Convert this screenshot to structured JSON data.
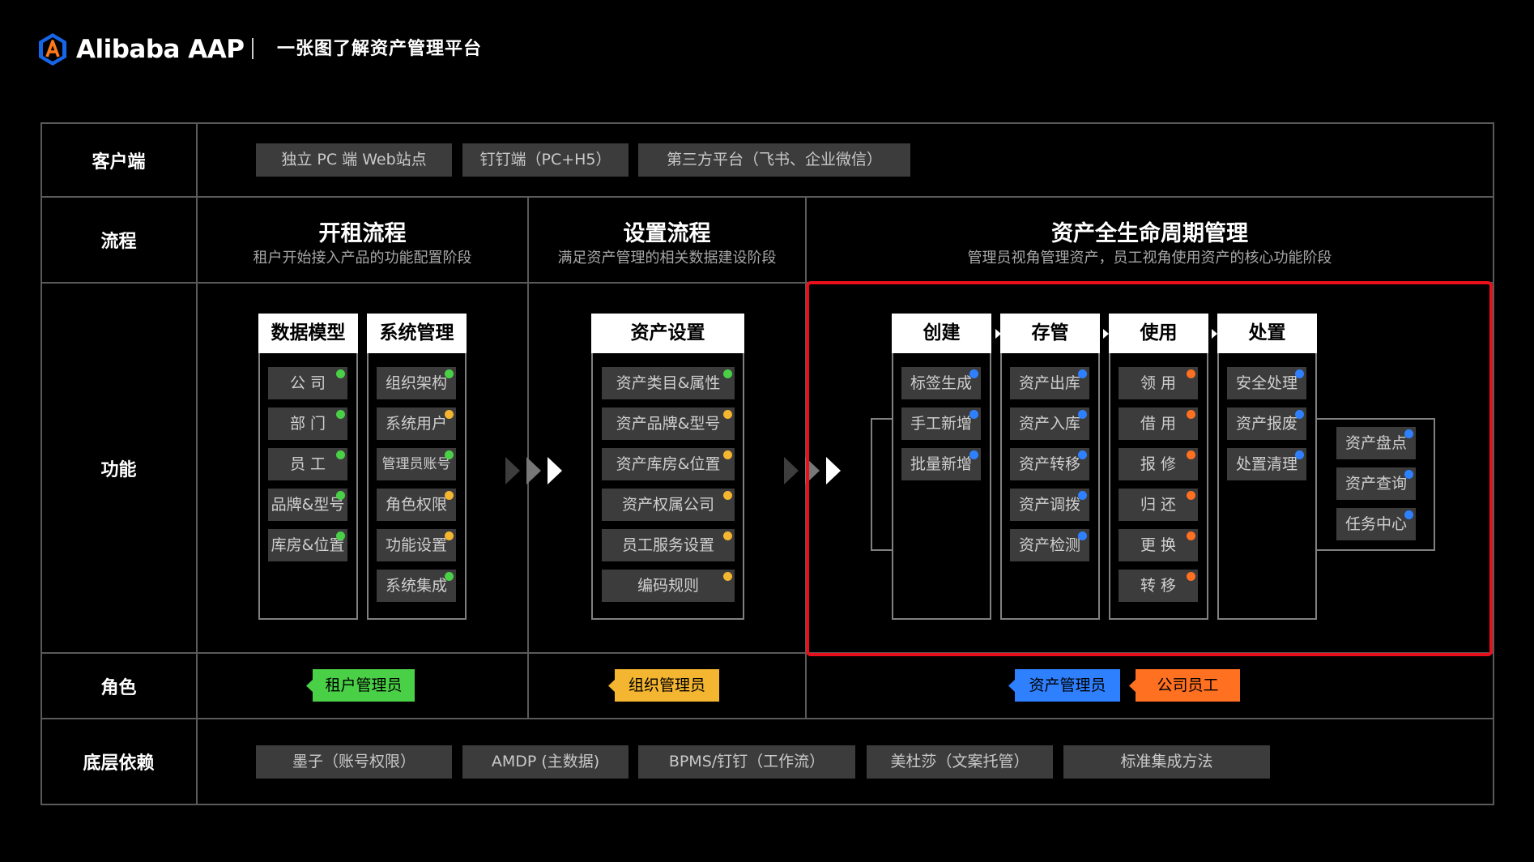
{
  "header": {
    "brand": "Alibaba AAP",
    "title": "一张图了解资产管理平台"
  },
  "rows": {
    "client": "客户端",
    "process": "流程",
    "function": "功能",
    "role": "角色",
    "foundation": "底层依赖"
  },
  "clients": [
    "独立 PC 端 Web站点",
    "钉钉端（PC+H5）",
    "第三方平台（飞书、企业微信）"
  ],
  "flows": [
    {
      "title": "开租流程",
      "subtitle": "租户开始接入产品的功能配置阶段"
    },
    {
      "title": "设置流程",
      "subtitle": "满足资产管理的相关数据建设阶段"
    },
    {
      "title": "资产全生命周期管理",
      "subtitle": "管理员视角管理资产，员工视角使用资产的核心功能阶段"
    }
  ],
  "modules": {
    "data_model": {
      "title": "数据模型",
      "items": [
        "公 司",
        "部 门",
        "员 工",
        "品牌&型号",
        "库房&位置"
      ]
    },
    "system_mgmt": {
      "title": "系统管理",
      "items": [
        "组织架构",
        "系统用户",
        "管理员账号",
        "角色权限",
        "功能设置",
        "系统集成"
      ]
    },
    "asset_setup": {
      "title": "资产设置",
      "items": [
        "资产类目&属性",
        "资产品牌&型号",
        "资产库房&位置",
        "资产权属公司",
        "员工服务设置",
        "编码规则"
      ]
    },
    "create": {
      "title": "创建",
      "items": [
        "标签生成",
        "手工新增",
        "批量新增"
      ]
    },
    "manage": {
      "title": "存管",
      "items": [
        "资产出库",
        "资产入库",
        "资产转移",
        "资产调拨",
        "资产检测"
      ]
    },
    "use": {
      "title": "使用",
      "items": [
        "领 用",
        "借 用",
        "报 修",
        "归 还",
        "更 换",
        "转 移"
      ]
    },
    "dispose": {
      "title": "处置",
      "items": [
        "安全处理",
        "资产报废",
        "处置清理"
      ]
    },
    "side": {
      "items": [
        "资产盘点",
        "资产查询",
        "任务中心"
      ]
    }
  },
  "roles": {
    "tenant_admin": "租户管理员",
    "org_admin": "组织管理员",
    "asset_admin": "资产管理员",
    "employee": "公司员工"
  },
  "foundation": [
    "墨子（账号权限）",
    "AMDP (主数据)",
    "BPMS/钉钉（工作流）",
    "美杜莎（文案托管）",
    "标准集成方法"
  ],
  "colors": {
    "green": "#4ad046",
    "yellow": "#f4b530",
    "blue": "#2f80ff",
    "orange": "#ff7020",
    "highlight": "#e8101c"
  }
}
